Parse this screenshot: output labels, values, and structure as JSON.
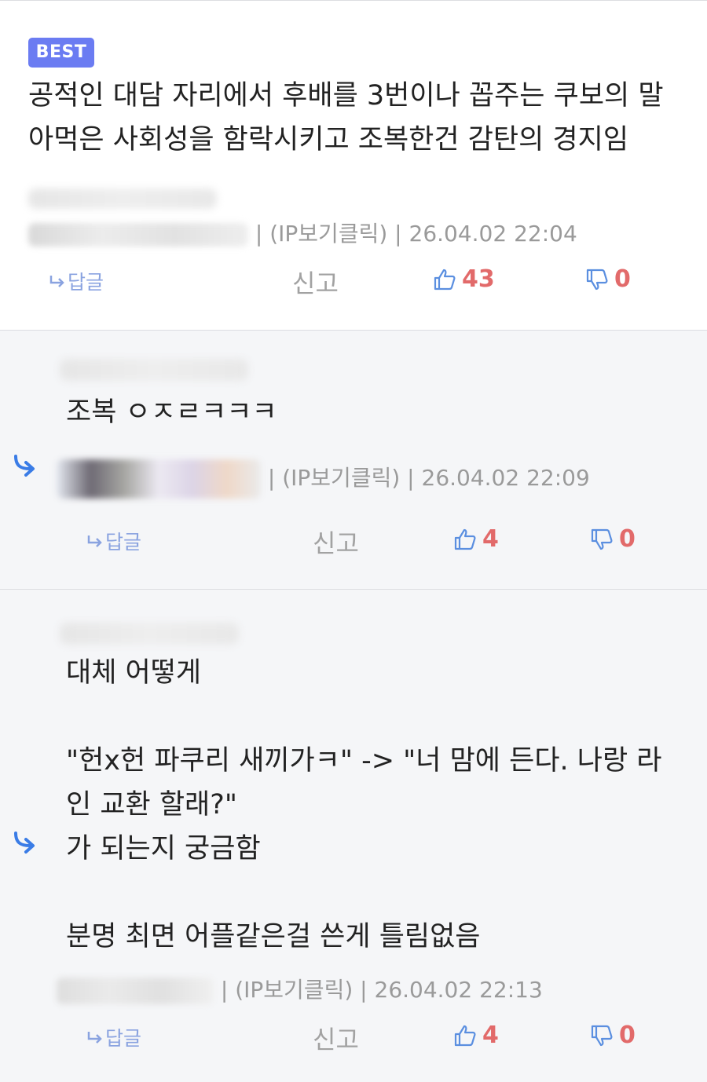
{
  "comments": [
    {
      "badge": "BEST",
      "body": [
        "공적인 대담 자리에서 후배를 3번이나 꼽주는 쿠보의 말아먹은 사회성을 함락시키고 조복한건 감탄의 경지임"
      ],
      "meta": " | (IP보기클릭) | 26.04.02 22:04",
      "reply_label": "답글",
      "report_label": "신고",
      "upvotes": "43",
      "downvotes": "0"
    },
    {
      "body": [
        "조복 ㅇㅈㄹㅋㅋㅋ"
      ],
      "meta": " | (IP보기클릭) | 26.04.02 22:09",
      "reply_label": "답글",
      "report_label": "신고",
      "upvotes": "4",
      "downvotes": "0"
    },
    {
      "body": [
        "대체 어떻게",
        "",
        "\"헌x헌 파쿠리 새끼가ㅋ\" -> \"너 맘에 든다. 나랑 라인 교환 할래?\"",
        "가 되는지 궁금함",
        "",
        "분명 최면 어플같은걸 쓴게 틀림없음"
      ],
      "meta": " | (IP보기클릭) | 26.04.02 22:13",
      "reply_label": "답글",
      "report_label": "신고",
      "upvotes": "4",
      "downvotes": "0"
    }
  ],
  "icons": {
    "reply": "reply-arrow-icon",
    "nested": "nested-reply-icon",
    "up": "thumbs-up-icon",
    "down": "thumbs-down-icon"
  },
  "colors": {
    "badge": "#6b7cf2",
    "vote": "#e26a6a",
    "reply": "#8aa3e0",
    "nested_arrow": "#3a7ce6",
    "reply_bg": "#f5f6f8"
  }
}
